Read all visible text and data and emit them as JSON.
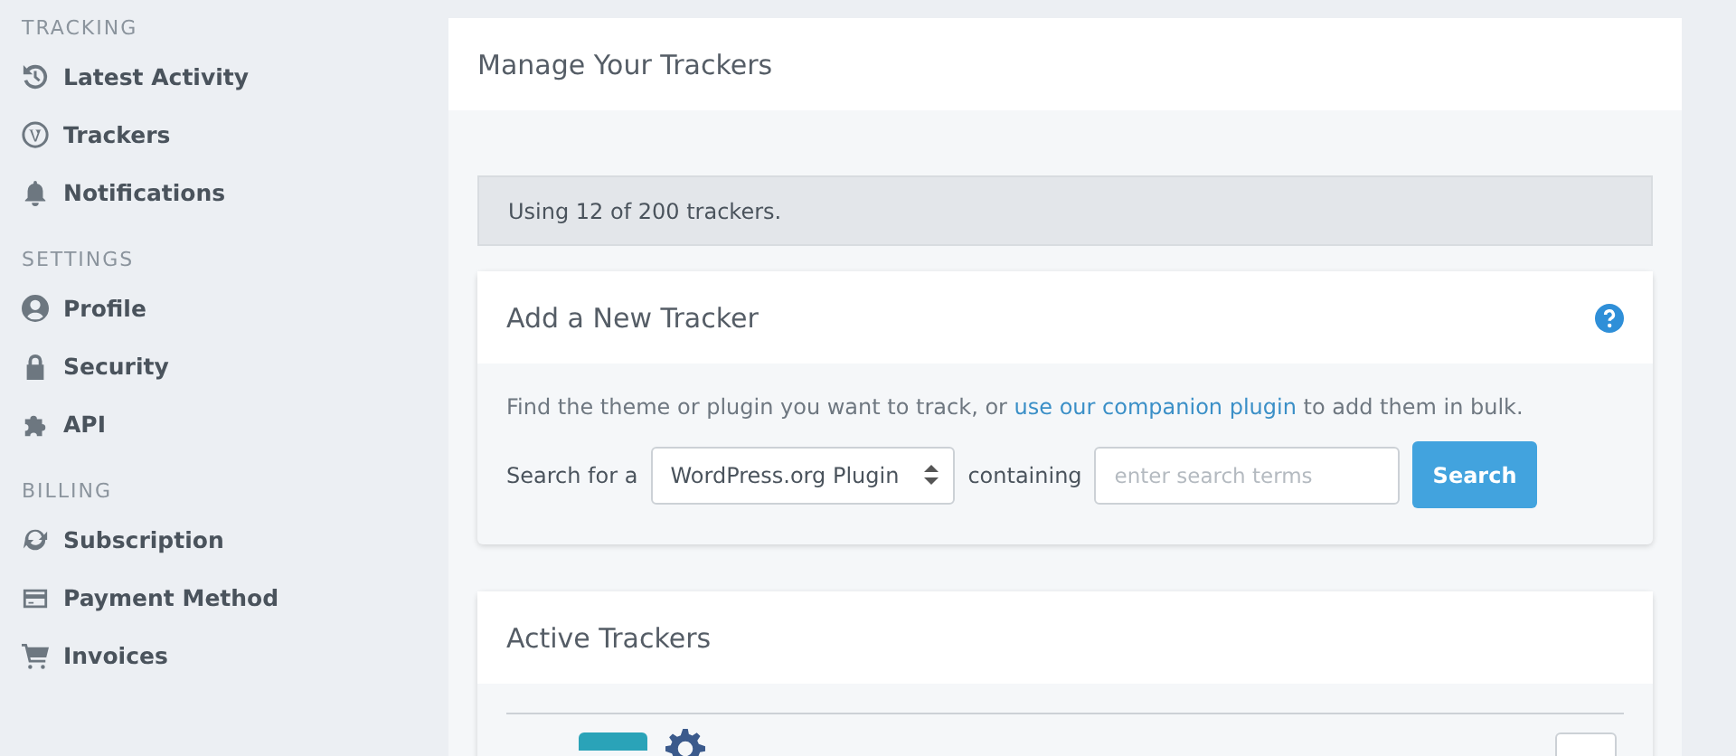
{
  "sidebar": {
    "sections": [
      {
        "heading": "TRACKING",
        "items": [
          {
            "label": "Latest Activity"
          },
          {
            "label": "Trackers"
          },
          {
            "label": "Notifications"
          }
        ]
      },
      {
        "heading": "SETTINGS",
        "items": [
          {
            "label": "Profile"
          },
          {
            "label": "Security"
          },
          {
            "label": "API"
          }
        ]
      },
      {
        "heading": "BILLING",
        "items": [
          {
            "label": "Subscription"
          },
          {
            "label": "Payment Method"
          },
          {
            "label": "Invoices"
          }
        ]
      }
    ]
  },
  "page": {
    "title": "Manage Your Trackers",
    "usage": "Using 12 of 200 trackers.",
    "add_tracker": {
      "title": "Add a New Tracker",
      "intro_before": "Find the theme or plugin you want to track, or ",
      "intro_link": "use our companion plugin",
      "intro_after": " to add them in bulk.",
      "search_label": "Search for a",
      "type_select": "WordPress.org Plugin",
      "containing_label": "containing",
      "search_field": {
        "placeholder": "enter search terms"
      },
      "search_button": "Search"
    },
    "active_trackers": {
      "title": "Active Trackers"
    }
  }
}
